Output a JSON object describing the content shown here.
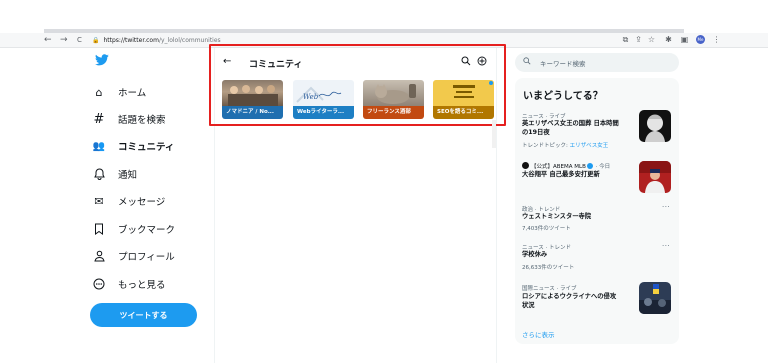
{
  "browser": {
    "url_host": "https://twitter.com",
    "url_path": "/y_lolol/communities",
    "back": "←",
    "forward": "→",
    "reload": "C",
    "profile_initials": "Me"
  },
  "nav": {
    "items": [
      {
        "icon": "home-icon",
        "glyph": "⌂",
        "label": "ホーム"
      },
      {
        "icon": "hashtag-icon",
        "glyph": "#",
        "label": "話題を検索"
      },
      {
        "icon": "communities-icon",
        "glyph": "👥",
        "label": "コミュニティ"
      },
      {
        "icon": "bell-icon",
        "glyph": "♫",
        "label": "通知"
      },
      {
        "icon": "envelope-icon",
        "glyph": "✉",
        "label": "メッセージ"
      },
      {
        "icon": "bookmark-icon",
        "glyph": "⊓",
        "label": "ブックマーク"
      },
      {
        "icon": "profile-icon",
        "glyph": "♙",
        "label": "プロフィール"
      },
      {
        "icon": "more-circle-icon",
        "glyph": "⋯",
        "label": "もっと見る"
      }
    ],
    "tweet_button": "ツイートする"
  },
  "main": {
    "back": "←",
    "title": "コミュニティ",
    "communities": [
      {
        "name": "ノマドニア / No...",
        "color": "#1f6fb0"
      },
      {
        "name": "Webライターラ...",
        "color": "#1d7fc4"
      },
      {
        "name": "フリーランス酒部",
        "color": "#c24a11"
      },
      {
        "name": "SEOを語るコミ...",
        "color": "#b17700"
      }
    ]
  },
  "sidebar": {
    "search_placeholder": "キーワード検索",
    "panel_title": "いまどうしてる？",
    "trends": [
      {
        "meta": "ニュース · ライブ",
        "title_lines": [
          "英エリザベス女王の国葬 日本時間",
          "の19日夜"
        ],
        "sub_prefix": "トレンドトピック: ",
        "sub_link": "エリザベス女王",
        "has_image": true
      },
      {
        "meta": "【公式】ABEMA MLB",
        "meta_suffix": " · 今日",
        "title_lines": [
          "大谷翔平 自己最多安打更新"
        ],
        "has_image": true
      },
      {
        "meta": "政治 · トレンド",
        "title_lines": [
          "ウェストミンスター寺院"
        ],
        "sub": "7,403件のツイート",
        "has_more": true
      },
      {
        "meta": "ニュース · トレンド",
        "title_lines": [
          "学校休み"
        ],
        "sub": "26,633件のツイート",
        "has_more": true
      },
      {
        "meta": "国際ニュース · ライブ",
        "title_lines": [
          "ロシアによるウクライナへの侵攻",
          "状況"
        ],
        "has_image": true
      }
    ],
    "show_more": "さらに表示"
  }
}
